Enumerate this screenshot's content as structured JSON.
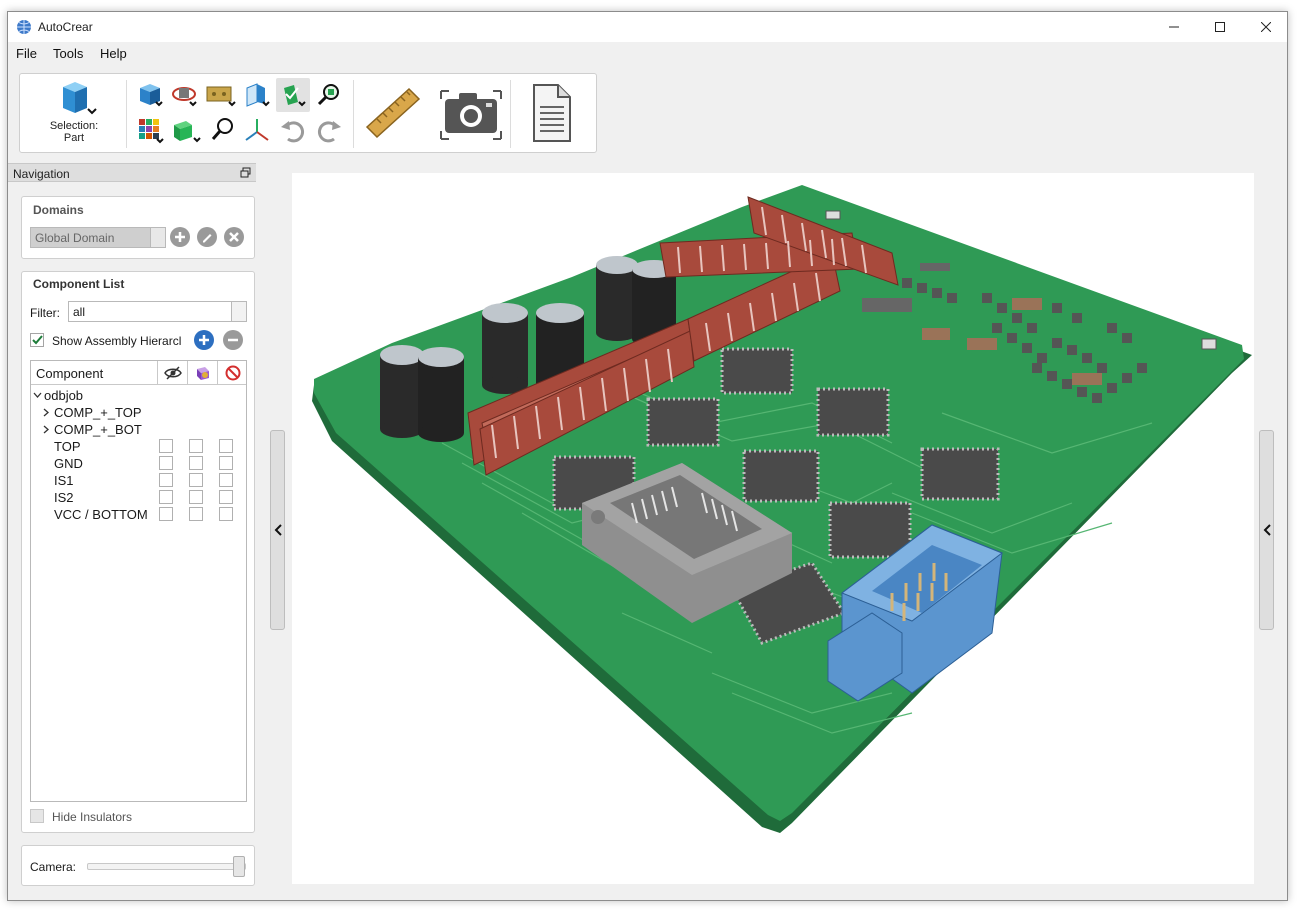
{
  "window": {
    "title": "AutoCrear"
  },
  "menu": {
    "items": [
      "File",
      "Tools",
      "Help"
    ]
  },
  "toolbar": {
    "selection_label": "Selection:",
    "selection_value": "Part",
    "icons": [
      "cube-selection-icon",
      "view-cube-icon",
      "rotate-view-icon",
      "pan-view-icon",
      "section-view-icon",
      "highlight-icon",
      "zoom-fit-icon",
      "color-palette-icon",
      "display-mode-icon",
      "zoom-icon",
      "axis-icon",
      "undo-icon",
      "redo-icon",
      "ruler-icon",
      "camera-icon",
      "report-icon"
    ]
  },
  "navigation": {
    "title": "Navigation",
    "domains": {
      "title": "Domains",
      "selected": "Global Domain"
    },
    "component_list": {
      "title": "Component List",
      "filter_label": "Filter:",
      "filter_value": "all",
      "show_hierarchy_label": "Show Assembly Hierarcl",
      "show_hierarchy_checked": true,
      "column_header": "Component",
      "root": "odbjob",
      "groups": [
        "COMP_+_TOP",
        "COMP_+_BOT"
      ],
      "layers": [
        "TOP",
        "GND",
        "IS1",
        "IS2",
        "VCC / BOTTOM"
      ],
      "hide_insulators_label": "Hide Insulators"
    },
    "camera": {
      "label": "Camera:",
      "value": 1.0
    }
  },
  "colors": {
    "pcb": "#2f9a55",
    "pcb_edge": "#1f6b3a",
    "connector_red": "#a84a3c",
    "chip": "#4a4a4a",
    "connector_blue": "#5b95cf",
    "socket": "#8f8f8f"
  }
}
